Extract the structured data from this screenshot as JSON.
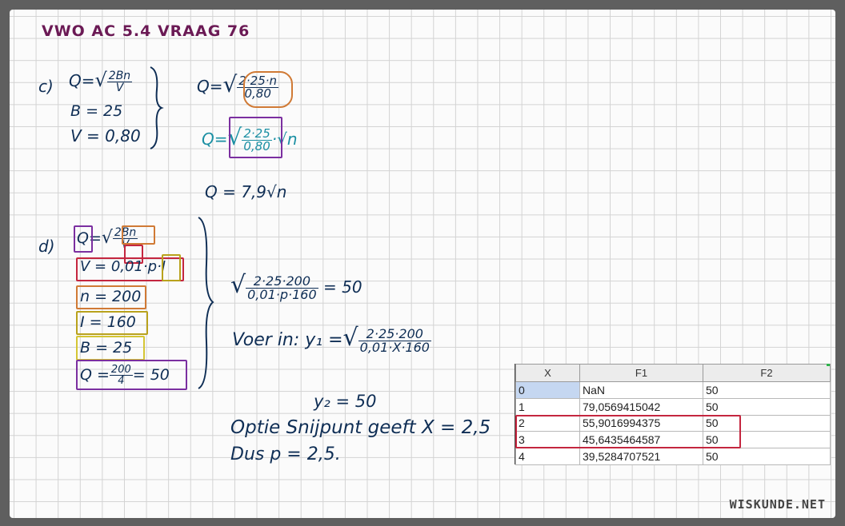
{
  "title": "VWO AC 5.4 VRAAG 76",
  "part_c": {
    "label": "c)",
    "formula": "Q=√(2Bn/V)",
    "b_line": "B = 25",
    "v_line": "V = 0,80",
    "step1_num": "2·25·n",
    "step1_den": "0,80",
    "step2_num": "2·25",
    "step2_den": "0,80",
    "step2_tail": "·√n",
    "result": "Q = 7,9√n"
  },
  "part_d": {
    "label": "d)",
    "q_letter": "Q",
    "q_eq": "=",
    "q_num": "2Bn",
    "q_den": "V",
    "v_line_a": "V = 0,01·p·",
    "v_line_i": "I",
    "n_line": "n = 200",
    "i_line": "I = 160",
    "b_line": "B = 25",
    "q_line_a": "Q =",
    "q_line_num": "200",
    "q_line_den": "4",
    "q_line_b": "= 50",
    "eq_num": "2·25·200",
    "eq_den": "0,01·p·160",
    "eq_rhs": "= 50",
    "voer_label": "Voer in:",
    "y1": "y₁ =",
    "y1_num": "2·25·200",
    "y1_den": "0,01·X·160",
    "y2": "y₂ = 50",
    "optie": "Optie Snijpunt geeft X = 2,5",
    "dus": "Dus p = 2,5."
  },
  "sheet": {
    "headers": [
      "X",
      "F1",
      "F2"
    ],
    "rows": [
      {
        "x": "0",
        "f1": "NaN",
        "f2": "50"
      },
      {
        "x": "1",
        "f1": "79,0569415042",
        "f2": "50"
      },
      {
        "x": "2",
        "f1": "55,9016994375",
        "f2": "50"
      },
      {
        "x": "3",
        "f1": "45,6435464587",
        "f2": "50"
      },
      {
        "x": "4",
        "f1": "39,5284707521",
        "f2": "50"
      }
    ]
  },
  "colors": {
    "title": "#6b1a55",
    "ink": "#0f2e55",
    "teal": "#1a8fa3",
    "purple": "#7b2fa0",
    "red": "#c4263f",
    "orange": "#d07a35",
    "olive": "#b9a21c"
  },
  "brand": "WISKUNDE.NET"
}
